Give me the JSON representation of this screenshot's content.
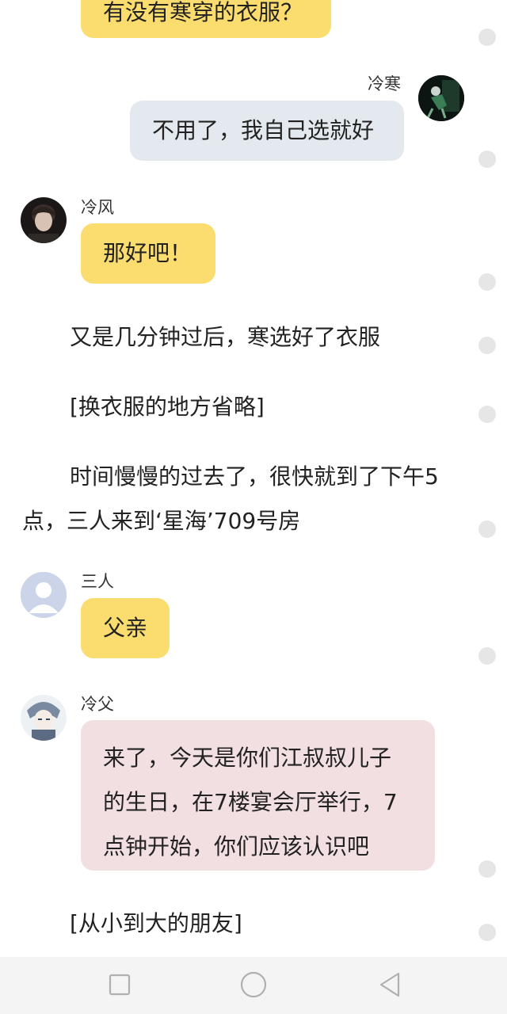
{
  "messages": {
    "m0_text": "有没有寒穿的衣服？",
    "m1_name": "冷寒",
    "m1_text": "不用了，我自己选就好",
    "m2_name": "冷风",
    "m2_text": "那好吧！",
    "m3_name": "三人",
    "m3_text": "父亲",
    "m4_name": "冷父",
    "m4_line1": "来了，今天是你们江叔叔儿子",
    "m4_line2": "的生日，在7楼宴会厅举行，7",
    "m4_line3": "点钟开始，你们应该认识吧"
  },
  "narration": {
    "n1": "又是几分钟过后，寒选好了衣服",
    "n2": "[换衣服的地方省略]",
    "n3_line1": "时间慢慢的过去了，很快就到了下午5",
    "n3_line2": "点，三人来到‘星海’709号房",
    "n4": "[从小到大的朋友]"
  },
  "nav": {
    "recent_icon": "square-icon",
    "home_icon": "circle-icon",
    "back_icon": "triangle-back-icon"
  },
  "colors": {
    "yellow_bubble": "#fbdc6f",
    "grey_bubble": "#e4e9ef",
    "pink_bubble": "#f2dfe1"
  }
}
